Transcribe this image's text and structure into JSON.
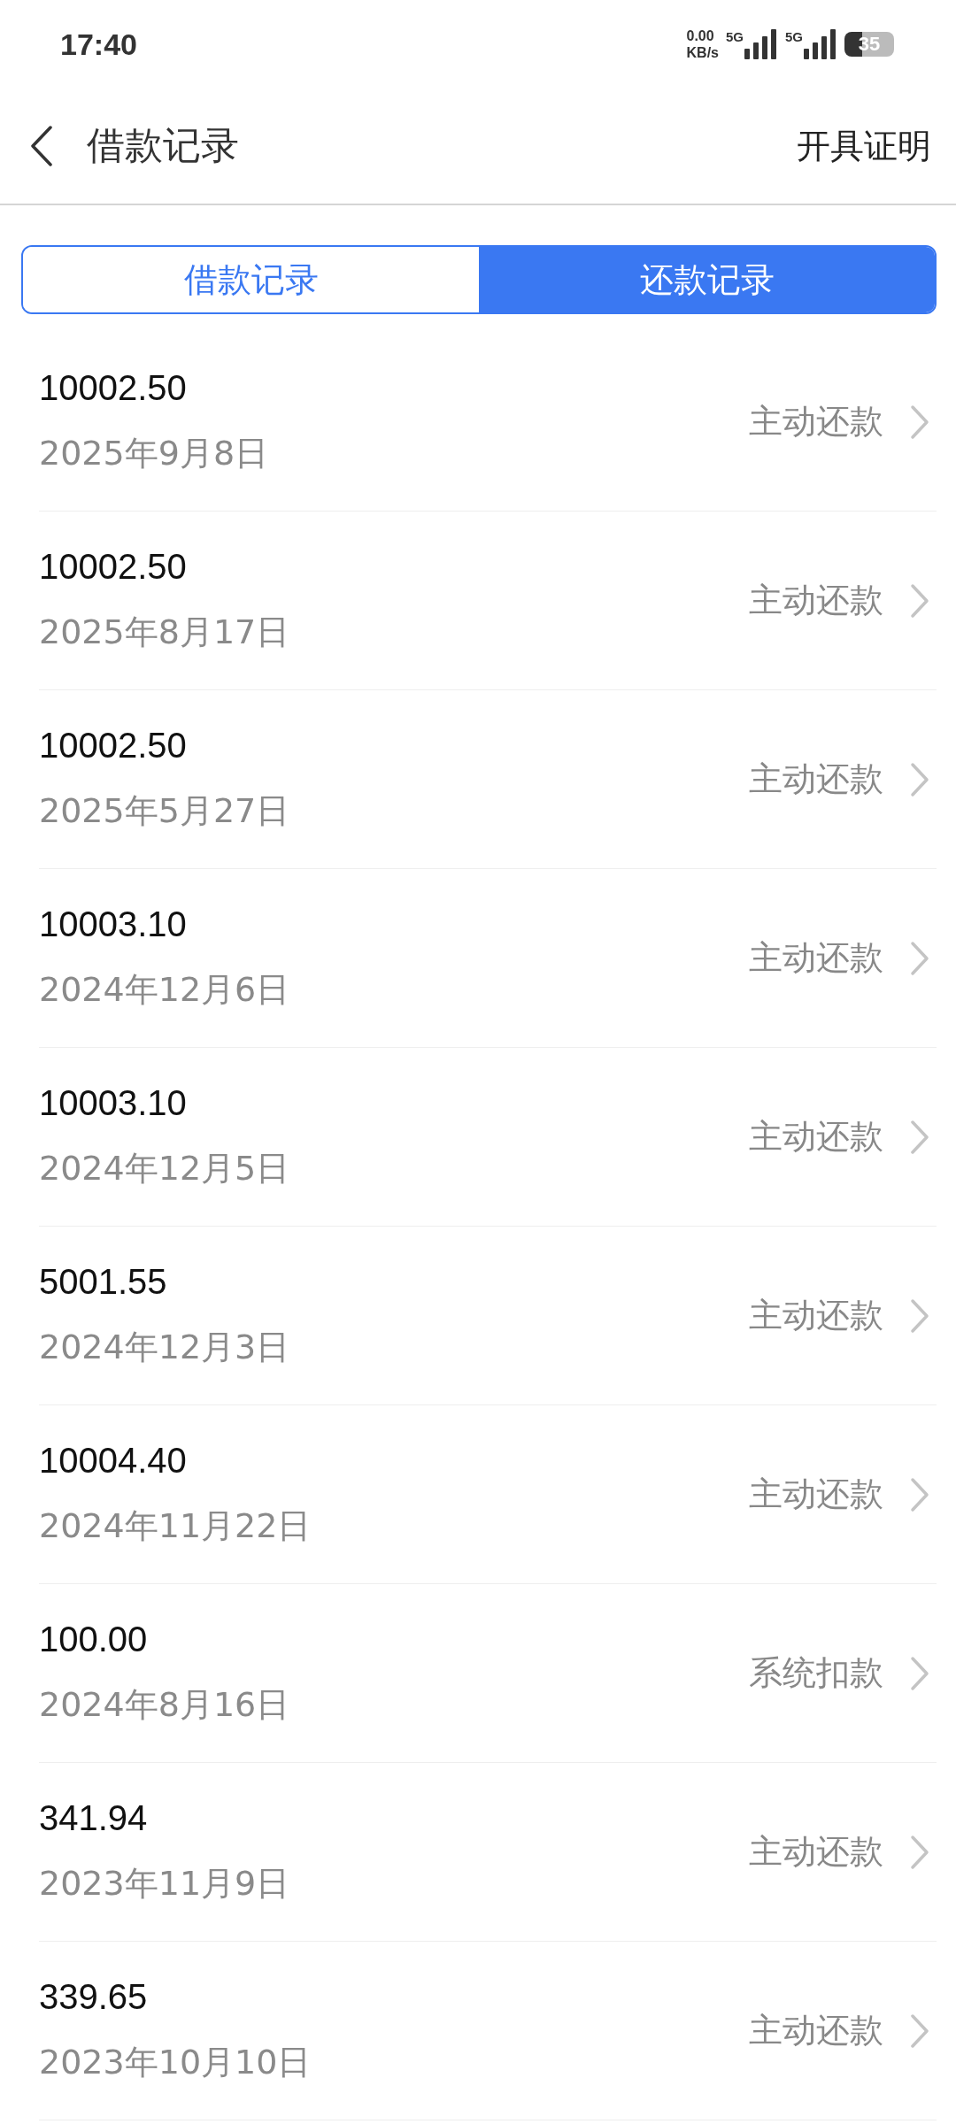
{
  "status_bar": {
    "time": "17:40",
    "net_speed": "0.00",
    "net_unit": "KB/s",
    "sim1": "5G",
    "sim2": "5G",
    "battery": "35"
  },
  "header": {
    "title": "借款记录",
    "action": "开具证明"
  },
  "tabs": [
    {
      "label": "借款记录",
      "selected": false
    },
    {
      "label": "还款记录",
      "selected": true
    }
  ],
  "records": [
    {
      "amount": "10002.50",
      "date": "2025年9月8日",
      "type": "主动还款"
    },
    {
      "amount": "10002.50",
      "date": "2025年8月17日",
      "type": "主动还款"
    },
    {
      "amount": "10002.50",
      "date": "2025年5月27日",
      "type": "主动还款"
    },
    {
      "amount": "10003.10",
      "date": "2024年12月6日",
      "type": "主动还款"
    },
    {
      "amount": "10003.10",
      "date": "2024年12月5日",
      "type": "主动还款"
    },
    {
      "amount": "5001.55",
      "date": "2024年12月3日",
      "type": "主动还款"
    },
    {
      "amount": "10004.40",
      "date": "2024年11月22日",
      "type": "主动还款"
    },
    {
      "amount": "100.00",
      "date": "2024年8月16日",
      "type": "系统扣款"
    },
    {
      "amount": "341.94",
      "date": "2023年11月9日",
      "type": "主动还款"
    },
    {
      "amount": "339.65",
      "date": "2023年10月10日",
      "type": "主动还款"
    }
  ]
}
